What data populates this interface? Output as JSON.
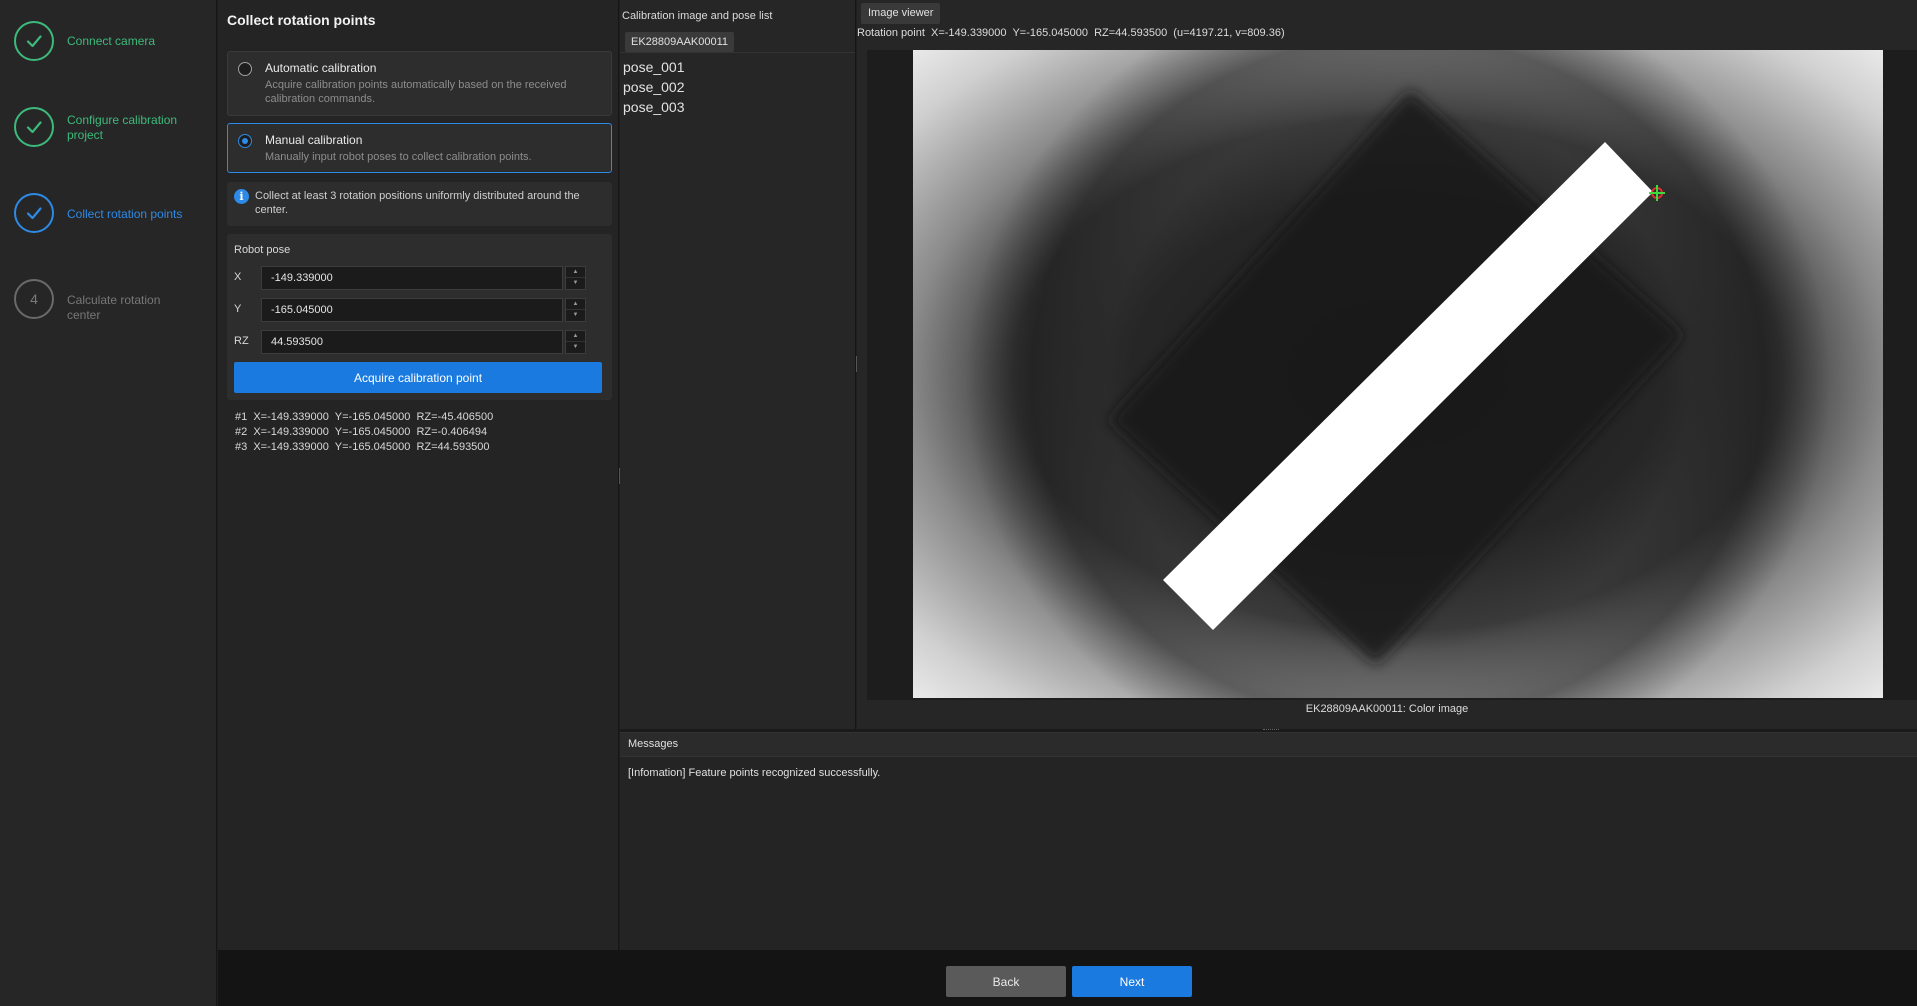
{
  "colors": {
    "done": "#3dba7b",
    "active": "#2d8ae6",
    "pending": "#777777",
    "primary_button": "#1a7ae0",
    "background": "#1f1f1f"
  },
  "steps": [
    {
      "label": "Connect camera",
      "state": "done",
      "icon": "check-icon"
    },
    {
      "label": "Configure calibration project",
      "state": "done",
      "icon": "check-icon"
    },
    {
      "label": "Collect rotation points",
      "state": "active",
      "icon": "check-icon"
    },
    {
      "label": "Calculate rotation center",
      "state": "pending",
      "number": "4"
    }
  ],
  "settings": {
    "title": "Collect rotation points",
    "auto": {
      "title": "Automatic calibration",
      "description": "Acquire calibration points automatically based on the received calibration commands.",
      "selected": false
    },
    "manual": {
      "title": "Manual calibration",
      "description": "Manually input robot poses to collect calibration points.",
      "selected": true
    },
    "info": "Collect at least 3 rotation positions uniformly distributed around the center.",
    "robot_pose": {
      "title": "Robot pose",
      "x_label": "X",
      "x_value": "-149.339000",
      "y_label": "Y",
      "y_value": "-165.045000",
      "rz_label": "RZ",
      "rz_value": "44.593500"
    },
    "acquire_label": "Acquire calibration point",
    "results": [
      "#1  X=-149.339000  Y=-165.045000  RZ=-45.406500",
      "#2  X=-149.339000  Y=-165.045000  RZ=-0.406494",
      "#3  X=-149.339000  Y=-165.045000  RZ=44.593500"
    ]
  },
  "pose_list": {
    "title": "Calibration image and pose list",
    "camera": "EK28809AAK00011",
    "items": [
      "pose_001",
      "pose_002",
      "pose_003"
    ]
  },
  "viewer": {
    "tab": "Image viewer",
    "readout": "Rotation point  X=-149.339000  Y=-165.045000  RZ=44.593500  (u=4197.21, v=809.36)",
    "caption": "EK28809AAK00011: Color image"
  },
  "messages": {
    "title": "Messages",
    "lines": [
      "[Infomation] Feature points recognized successfully."
    ]
  },
  "footer": {
    "back_label": "Back",
    "next_label": "Next"
  }
}
